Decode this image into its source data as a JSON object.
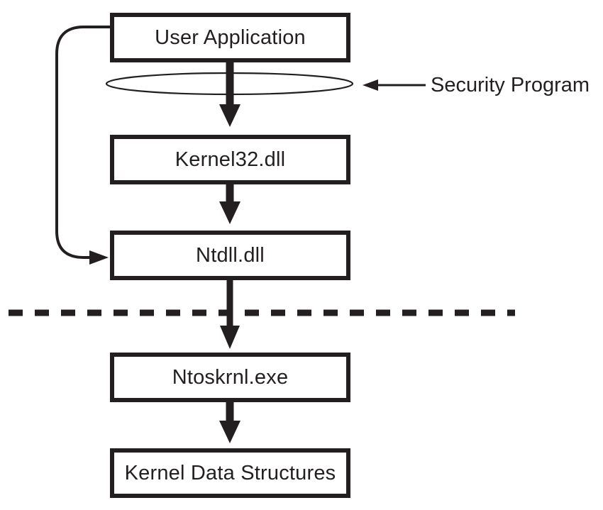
{
  "diagram": {
    "title": "Windows API call path with security program hook",
    "stroke_color": "#231f20",
    "background_color": "#ffffff",
    "nodes": [
      {
        "id": "user-application",
        "label": "User Application"
      },
      {
        "id": "kernel32",
        "label": "Kernel32.dll"
      },
      {
        "id": "ntdll",
        "label": "Ntdll.dll"
      },
      {
        "id": "ntoskrnl",
        "label": "Ntoskrnl.exe"
      },
      {
        "id": "kernel-data",
        "label": "Kernel Data Structures"
      }
    ],
    "annotations": [
      {
        "id": "security-program",
        "label": "Security Program"
      }
    ],
    "shapes": {
      "hook_ellipse": "security-hook-ellipse",
      "boundary": "user-kernel-boundary-dashed-line"
    },
    "edges": [
      {
        "from": "user-application",
        "to": "kernel32",
        "style": "solid-arrow"
      },
      {
        "from": "kernel32",
        "to": "ntdll",
        "style": "solid-arrow"
      },
      {
        "from": "ntdll",
        "to": "ntoskrnl",
        "style": "solid-arrow"
      },
      {
        "from": "ntoskrnl",
        "to": "kernel-data",
        "style": "solid-arrow"
      },
      {
        "from": "user-application",
        "to": "ntdll",
        "style": "curved-bypass-arrow"
      },
      {
        "from": "security-program",
        "to": "hook-ellipse",
        "style": "thin-arrow"
      }
    ]
  }
}
